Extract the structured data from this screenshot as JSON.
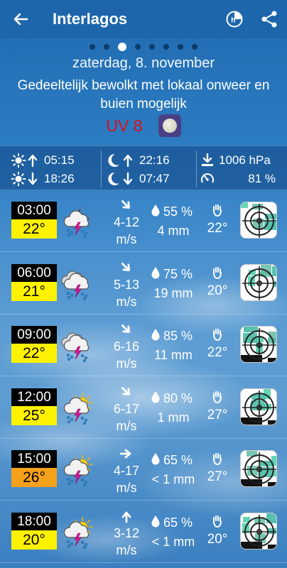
{
  "header": {
    "title": "Interlagos",
    "icons": [
      "back-arrow-icon",
      "history-icon",
      "share-icon"
    ]
  },
  "pager": {
    "count": 8,
    "active": 2
  },
  "day": {
    "date": "zaterdag, 8. november",
    "description": "Gedeeltelijk bewolkt met lokaal onweer en buien mogelijk",
    "uv": "UV 8"
  },
  "info": {
    "sunrise": "05:15",
    "sunset": "18:26",
    "moonrise": "22:16",
    "moonset": "07:47",
    "pressure": "1006 hPa",
    "humidity": "81 %"
  },
  "colors": {
    "appbar": "#1d66ab",
    "temp_yellow": "#fff200",
    "temp_orange": "#f6a11a",
    "uv_red": "#d8101f"
  },
  "forecast": [
    {
      "time": "03:00",
      "temp": "22°",
      "temp_color": "yellow",
      "icon": "night-thunder-rain-icon",
      "wind_dir": "south-east",
      "wind_line1": "4-12",
      "wind_line2": "m/s",
      "precip_prob": "55 %",
      "precip": "4 mm",
      "feels": "22°"
    },
    {
      "time": "06:00",
      "temp": "21°",
      "temp_color": "yellow",
      "icon": "cloud-thunder-rain-icon",
      "wind_dir": "south-east",
      "wind_line1": "5-13",
      "wind_line2": "m/s",
      "precip_prob": "75 %",
      "precip": "19 mm",
      "feels": "20°"
    },
    {
      "time": "09:00",
      "temp": "22°",
      "temp_color": "yellow",
      "icon": "cloud-thunder-rain-icon",
      "wind_dir": "south-east",
      "wind_line1": "6-16",
      "wind_line2": "m/s",
      "precip_prob": "85 %",
      "precip": "11 mm",
      "feels": "22°"
    },
    {
      "time": "12:00",
      "temp": "25°",
      "temp_color": "yellow",
      "icon": "sun-thunder-rain-icon",
      "wind_dir": "south-east",
      "wind_line1": "6-17",
      "wind_line2": "m/s",
      "precip_prob": "80 %",
      "precip": "1 mm",
      "feels": "27°"
    },
    {
      "time": "15:00",
      "temp": "26°",
      "temp_color": "orange",
      "icon": "sun-thunder-rain-icon",
      "wind_dir": "east",
      "wind_line1": "4-17",
      "wind_line2": "m/s",
      "precip_prob": "65 %",
      "precip": "< 1 mm",
      "feels": "27°"
    },
    {
      "time": "18:00",
      "temp": "20°",
      "temp_color": "yellow",
      "icon": "sun-thunder-rain-icon",
      "wind_dir": "north",
      "wind_line1": "3-12",
      "wind_line2": "m/s",
      "precip_prob": "65 %",
      "precip": "< 1 mm",
      "feels": "20°"
    }
  ]
}
